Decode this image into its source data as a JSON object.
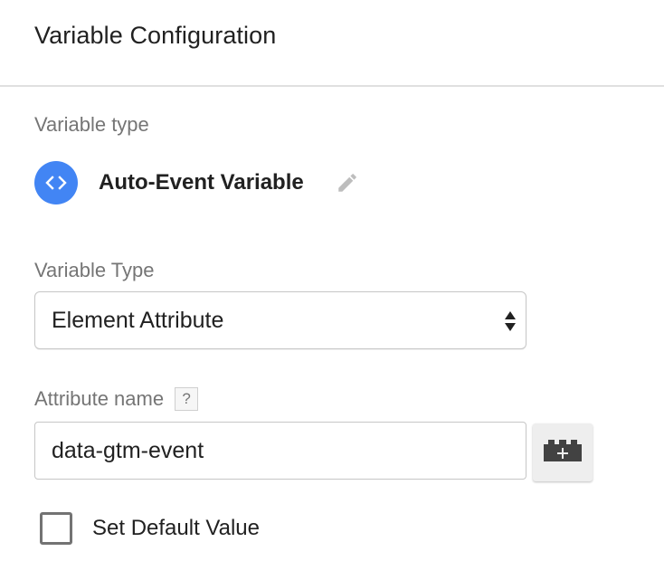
{
  "header": {
    "title": "Variable Configuration"
  },
  "variable_type_section": {
    "label": "Variable type",
    "type_name": "Auto-Event Variable",
    "type_icon": "code-brackets-icon",
    "edit_icon": "pencil-icon"
  },
  "variable_type_select": {
    "label": "Variable Type",
    "selected_value": "Element Attribute"
  },
  "attribute_name": {
    "label": "Attribute name",
    "help_text": "?",
    "value": "data-gtm-event",
    "picker_icon": "variable-block-plus-icon"
  },
  "default_value": {
    "label": "Set Default Value",
    "checked": false
  },
  "colors": {
    "accent": "#4285f4",
    "label_gray": "#757575",
    "border": "#c6c6c6",
    "divider": "#e0e0e0"
  }
}
